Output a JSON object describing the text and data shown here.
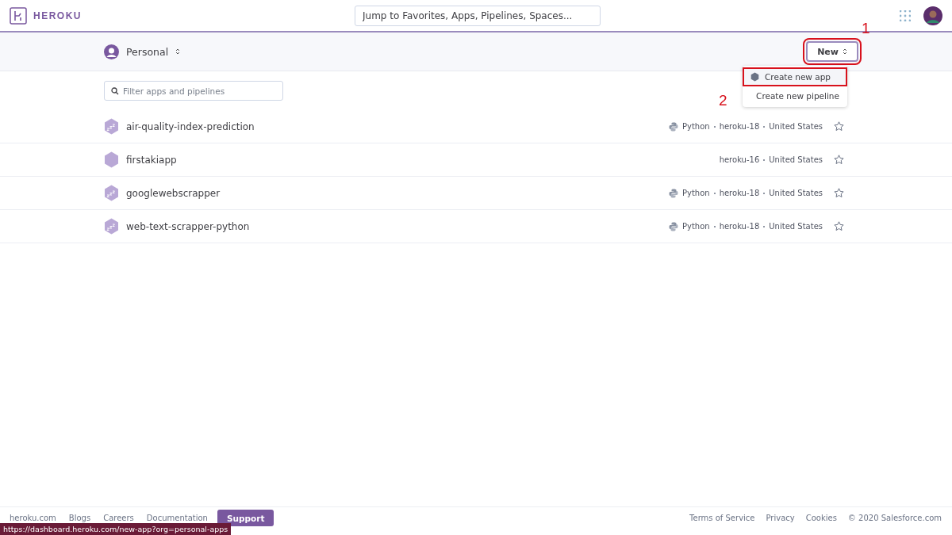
{
  "header": {
    "logo_text": "HEROKU",
    "search": {
      "placeholder": "Jump to Favorites, Apps, Pipelines, Spaces..."
    }
  },
  "account": {
    "label": "Personal"
  },
  "new_button": {
    "label": "New",
    "expanded": true,
    "step": "1"
  },
  "new_menu": [
    {
      "label": "Create new app",
      "kind": "app",
      "selected": true,
      "step": "2"
    },
    {
      "label": "Create new pipeline",
      "kind": "pipeline",
      "selected": false
    }
  ],
  "filter": {
    "placeholder": "Filter apps and pipelines"
  },
  "apps": [
    {
      "name": "air-quality-index-prediction",
      "sleeping": true,
      "language": "Python",
      "stack": "heroku-18",
      "region": "United States",
      "starred": false
    },
    {
      "name": "firstakiapp",
      "sleeping": false,
      "stack": "heroku-16",
      "region": "United States",
      "starred": false
    },
    {
      "name": "googlewebscrapper",
      "sleeping": true,
      "language": "Python",
      "stack": "heroku-18",
      "region": "United States",
      "starred": false
    },
    {
      "name": "web-text-scrapper-python",
      "sleeping": true,
      "language": "Python",
      "stack": "heroku-18",
      "region": "United States",
      "starred": false
    }
  ],
  "footer": {
    "links": [
      "heroku.com",
      "Blogs",
      "Careers",
      "Documentation"
    ],
    "support": "Support",
    "right_links": [
      "Terms of Service",
      "Privacy",
      "Cookies"
    ],
    "copyright": "© 2020 Salesforce.com"
  },
  "status_url": "https://dashboard.heroku.com/new-app?org=personal-apps"
}
